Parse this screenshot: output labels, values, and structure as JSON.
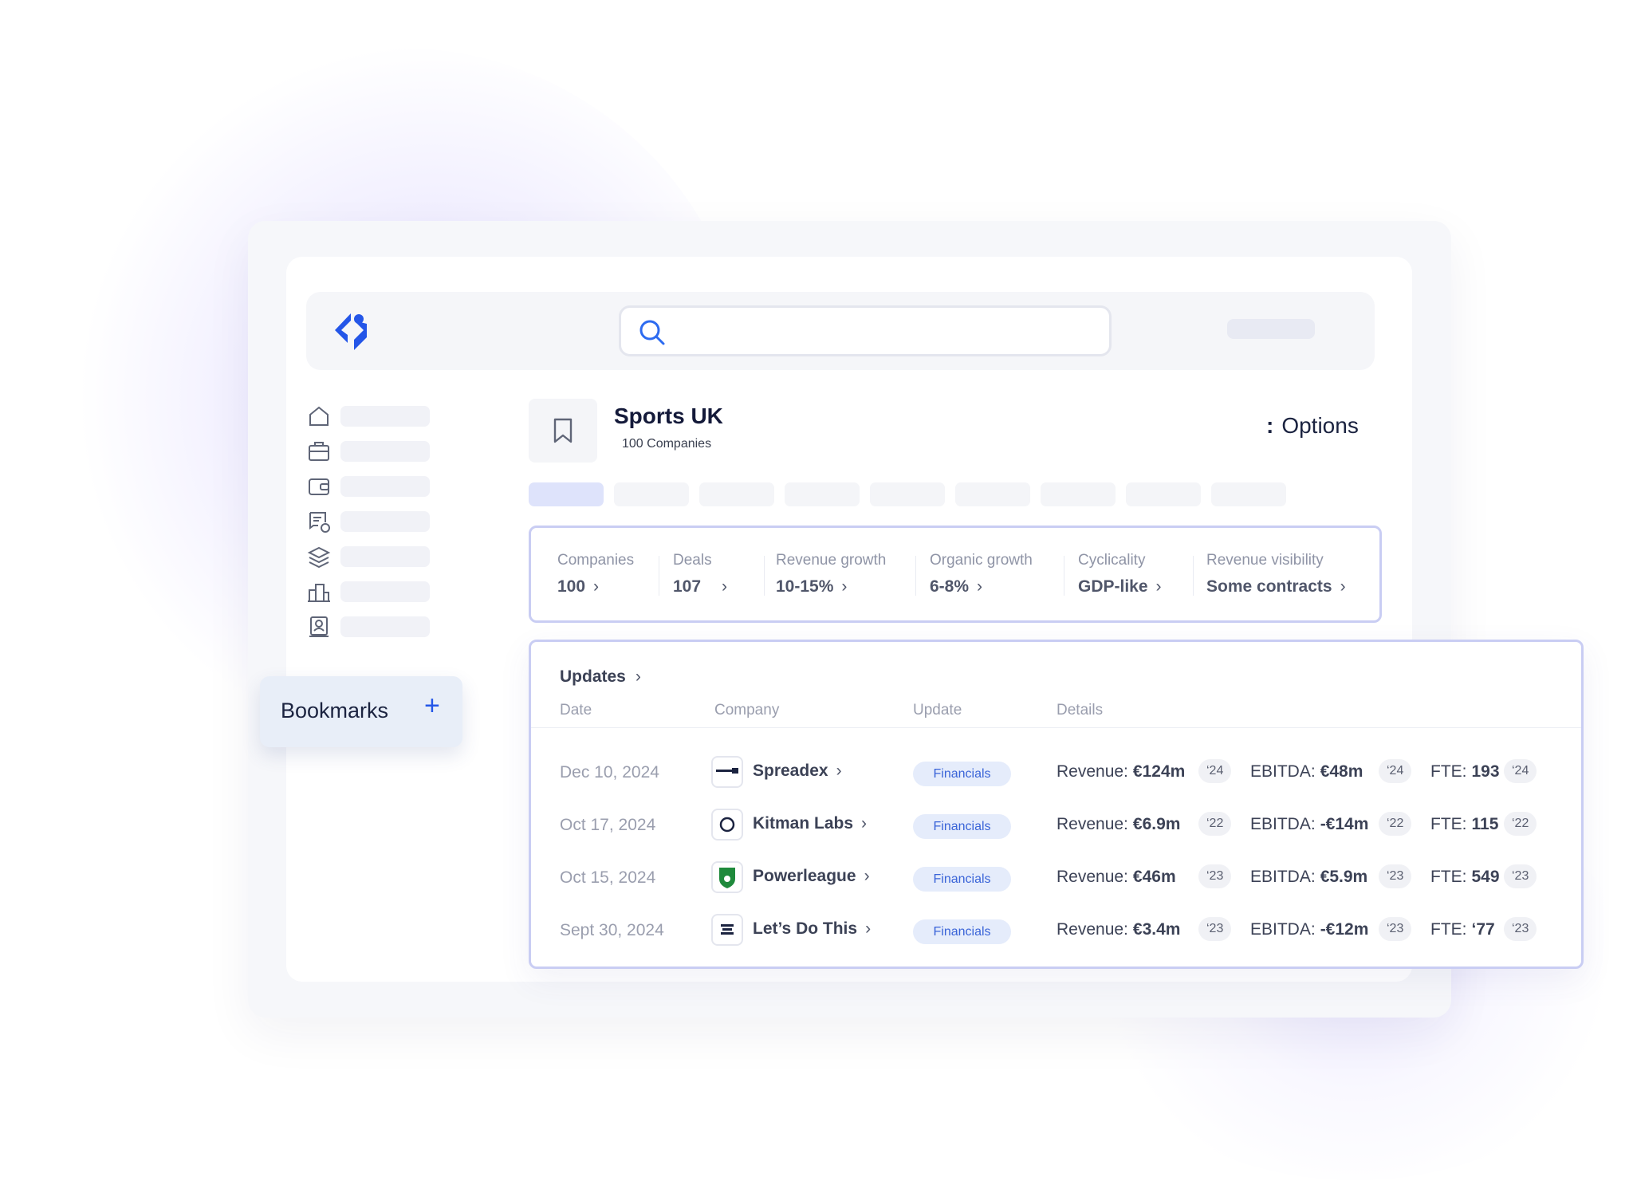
{
  "list": {
    "title": "Sports UK",
    "subtitle": "100 Companies",
    "options_label": "Options"
  },
  "kpis": [
    {
      "label": "Companies",
      "value": "100"
    },
    {
      "label": "Deals",
      "value": "107"
    },
    {
      "label": "Revenue growth",
      "value": "10-15%"
    },
    {
      "label": "Organic growth",
      "value": "6-8%"
    },
    {
      "label": "Cyclicality",
      "value": "GDP-like"
    },
    {
      "label": "Revenue visibility",
      "value": "Some contracts"
    }
  ],
  "bookmarks": {
    "label": "Bookmarks",
    "plus": "+"
  },
  "updates": {
    "title": "Updates",
    "columns": {
      "date": "Date",
      "company": "Company",
      "update": "Update",
      "details": "Details"
    },
    "metric_labels": {
      "revenue": "Revenue:",
      "ebitda": "EBITDA:",
      "fte": "FTE:"
    },
    "rows": [
      {
        "date": "Dec 10, 2024",
        "company": "Spreadex",
        "update": "Financials",
        "revenue": "€124m",
        "revenue_year": "‘24",
        "ebitda": "€48m",
        "ebitda_year": "‘24",
        "fte": "193",
        "fte_year": "‘24"
      },
      {
        "date": "Oct 17, 2024",
        "company": "Kitman Labs",
        "update": "Financials",
        "revenue": "€6.9m",
        "revenue_year": "‘22",
        "ebitda": "-€14m",
        "ebitda_year": "‘22",
        "fte": "115",
        "fte_year": "‘22"
      },
      {
        "date": "Oct 15, 2024",
        "company": "Powerleague",
        "update": "Financials",
        "revenue": "€46m",
        "revenue_year": "‘23",
        "ebitda": "€5.9m",
        "ebitda_year": "‘23",
        "fte": "549",
        "fte_year": "‘23"
      },
      {
        "date": "Sept 30, 2024",
        "company": "Let’s Do This",
        "update": "Financials",
        "revenue": "€3.4m",
        "revenue_year": "‘23",
        "ebitda": "-€12m",
        "ebitda_year": "‘23",
        "fte": "‘77",
        "fte_year": "‘23"
      }
    ]
  },
  "colors": {
    "accent": "#2456e8",
    "card_border": "#c9cdf3",
    "pill_bg": "#e5ecfb",
    "pill_text": "#3a64d8"
  },
  "icons": {
    "logo": "app-logo",
    "search": "search-icon",
    "nav": [
      "home-icon",
      "briefcase-icon",
      "wallet-icon",
      "invoice-euro-icon",
      "layers-icon",
      "buildings-icon",
      "profile-icon"
    ],
    "bookmark": "bookmark-icon",
    "options": "more-vertical-icon"
  }
}
